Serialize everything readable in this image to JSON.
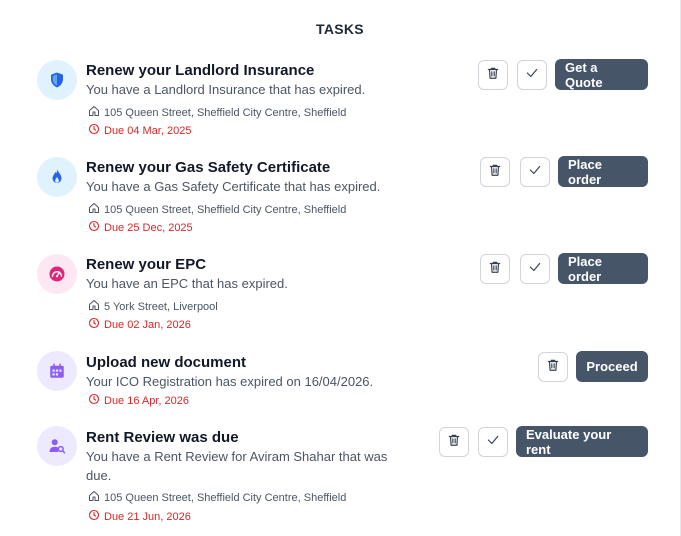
{
  "header": {
    "title": "TASKS"
  },
  "tasks": [
    {
      "title": "Renew your Landlord Insurance",
      "description": "You have a Landlord Insurance that has expired.",
      "address": "105 Queen Street, Sheffield City Centre, Sheffield",
      "due": "Due 04 Mar, 2025",
      "icon": "shield-icon",
      "action_label": "Get a Quote"
    },
    {
      "title": "Renew your Gas Safety Certificate",
      "description": "You have a Gas Safety Certificate that has expired.",
      "address": "105 Queen Street, Sheffield City Centre, Sheffield",
      "due": "Due 25 Dec, 2025",
      "icon": "flame-icon",
      "action_label": "Place order"
    },
    {
      "title": "Renew your EPC",
      "description": "You have an EPC that has expired.",
      "address": "5 York Street, Liverpool",
      "due": "Due 02 Jan, 2026",
      "icon": "gauge-icon",
      "action_label": "Place order"
    },
    {
      "title": "Upload new document",
      "description": "Your ICO Registration has expired on 16/04/2026.",
      "due": "Due 16 Apr, 2026",
      "icon": "calendar-icon",
      "action_label": "Proceed"
    },
    {
      "title": "Rent Review was due",
      "description_line1": "You have a Rent Review for Aviram Shahar that was",
      "description_line2": "due.",
      "address": "105 Queen Street, Sheffield City Centre, Sheffield",
      "due": "Due 21 Jun, 2026",
      "icon": "user-search-icon",
      "action_label": "Evaluate your rent"
    }
  ],
  "colors": {
    "due_red": "#dc2626",
    "action_button": "#475569",
    "shield_bg": "#e0f2fe",
    "flame_bg": "#e0f2fe",
    "gauge_bg": "#fce7f3",
    "calendar_bg": "#ede9fe",
    "user_bg": "#ede9fe"
  }
}
